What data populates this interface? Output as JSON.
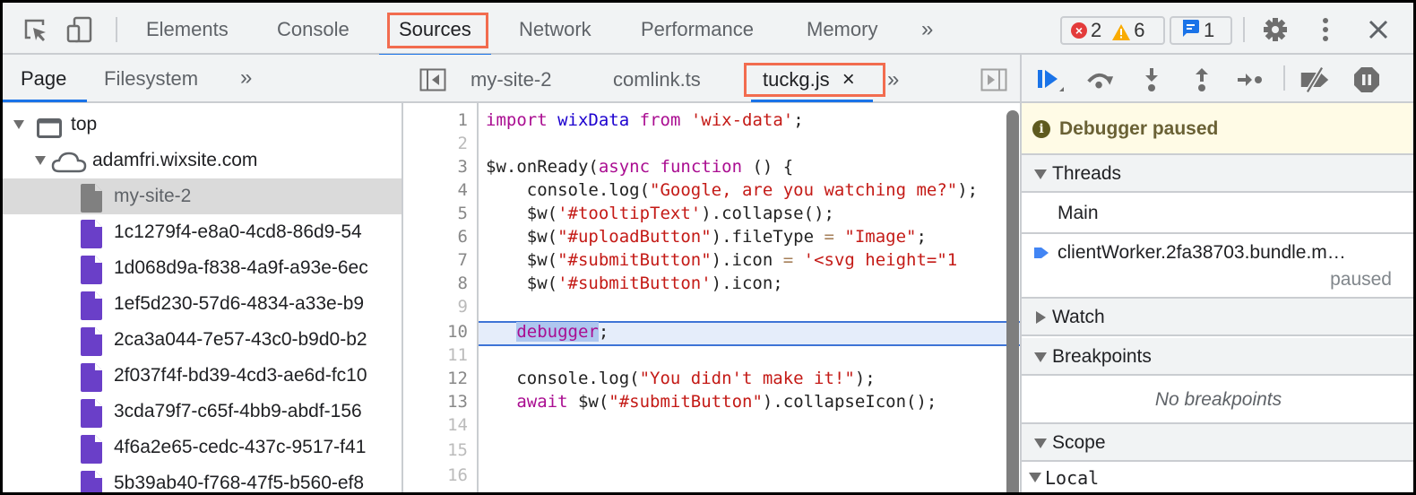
{
  "toolbar": {
    "tabs": [
      "Elements",
      "Console",
      "Sources",
      "Network",
      "Performance",
      "Memory"
    ],
    "active_tab": "Sources",
    "more_tabs": "»",
    "errors_count": "2",
    "warnings_count": "6",
    "messages_count": "1",
    "icons": [
      "inspect-element-icon",
      "device-toggle-icon",
      "settings-gear-icon",
      "more-vertical-icon",
      "close-icon"
    ]
  },
  "navigator": {
    "tabs": [
      "Page",
      "Filesystem"
    ],
    "active_tab": "Page",
    "more_tabs": "»",
    "tree": [
      {
        "label": "top",
        "level": 0,
        "icon": "frame-icon",
        "expanded": true
      },
      {
        "label": "adamfri.wixsite.com",
        "level": 1,
        "icon": "cloud-icon",
        "expanded": true
      },
      {
        "label": "my-site-2",
        "level": 2,
        "icon": "document-icon",
        "selected": true
      },
      {
        "label": "1c1279f4-e8a0-4cd8-86d9-54",
        "level": 2,
        "icon": "script-file-icon"
      },
      {
        "label": "1d068d9a-f838-4a9f-a93e-6ec",
        "level": 2,
        "icon": "script-file-icon"
      },
      {
        "label": "1ef5d230-57d6-4834-a33e-b9",
        "level": 2,
        "icon": "script-file-icon"
      },
      {
        "label": "2ca3a044-7e57-43c0-b9d0-b2",
        "level": 2,
        "icon": "script-file-icon"
      },
      {
        "label": "2f037f4f-bd39-4cd3-ae6d-fc10",
        "level": 2,
        "icon": "script-file-icon"
      },
      {
        "label": "3cda79f7-c65f-4bb9-abdf-156",
        "level": 2,
        "icon": "script-file-icon"
      },
      {
        "label": "4f6a2e65-cedc-437c-9517-f41",
        "level": 2,
        "icon": "script-file-icon"
      },
      {
        "label": "5b39ab40-f768-47f5-b560-ef8",
        "level": 2,
        "icon": "script-file-icon"
      }
    ]
  },
  "editor": {
    "tabs": [
      "my-site-2",
      "comlink.ts",
      "tuckg.js"
    ],
    "active_tab": "tuckg.js",
    "close_glyph": "×",
    "more_tabs": "»",
    "paused_line": 10,
    "line_numbers": [
      "1",
      "2",
      "3",
      "4",
      "5",
      "6",
      "7",
      "8",
      "9",
      "10",
      "11",
      "12",
      "13",
      "14",
      "15",
      "16"
    ],
    "lines": [
      "import wixData from 'wix-data';",
      "",
      "$w.onReady(async function () {",
      "    console.log(\"Google, are you watching me?\");",
      "    $w('#tooltipText').collapse();",
      "    $w(\"#uploadButton\").fileType = \"Image\";",
      "    $w(\"#submitButton\").icon = '<svg height=\"",
      "    $w('#submitButton').icon;",
      "",
      "   debugger;",
      "",
      "   console.log(\"You didn't make it!\");",
      "   await $w(\"#submitButton\").collapseIcon();",
      "",
      "",
      ""
    ],
    "tokens": {
      "l1": [
        "import",
        " ",
        "wixData",
        " ",
        "from",
        " ",
        "'wix-data'",
        ";"
      ],
      "l3": [
        "$w.onReady(",
        "async",
        " ",
        "function",
        " () {"
      ],
      "l4": [
        "    console.log(",
        "\"Google, are you watching me?\"",
        ");"
      ],
      "l5": [
        "    $w(",
        "'#tooltipText'",
        ").collapse();"
      ],
      "l6": [
        "    $w(",
        "\"#uploadButton\"",
        ").fileType ",
        "=",
        " ",
        "\"Image\"",
        ";"
      ],
      "l7": [
        "    $w(",
        "\"#submitButton\"",
        ").icon ",
        "=",
        " ",
        "'<svg height=\"1"
      ],
      "l8": [
        "    $w(",
        "'#submitButton'",
        ").icon;"
      ],
      "l10": [
        "   ",
        "debugger",
        ";"
      ],
      "l12": [
        "   console.log(",
        "\"You didn't make it!\"",
        ");"
      ],
      "l13": [
        "   ",
        "await",
        " $w(",
        "\"#submitButton\"",
        ").collapseIcon();"
      ]
    }
  },
  "debugger": {
    "controls": [
      "resume-icon",
      "step-over-icon",
      "step-into-icon",
      "step-out-icon",
      "step-icon",
      "deactivate-breakpoints-icon",
      "pause-on-exceptions-icon"
    ],
    "paused_message": "Debugger paused",
    "sections": {
      "threads": "Threads",
      "watch": "Watch",
      "breakpoints": "Breakpoints",
      "scope": "Scope"
    },
    "threads": [
      {
        "name": "Main",
        "status": ""
      },
      {
        "name": "clientWorker.2fa38703.bundle.m…",
        "status": "paused",
        "current": true
      }
    ],
    "no_breakpoints": "No breakpoints",
    "scope_local": "Local"
  },
  "colors": {
    "accent": "#1a73e8",
    "highlight_box": "#f26c4f",
    "keyword": "#aa0d91",
    "string": "#c41a16",
    "variable": "#1c00cf",
    "paused_banner_bg": "#fffbe6",
    "script_file": "#6a3fc8"
  }
}
